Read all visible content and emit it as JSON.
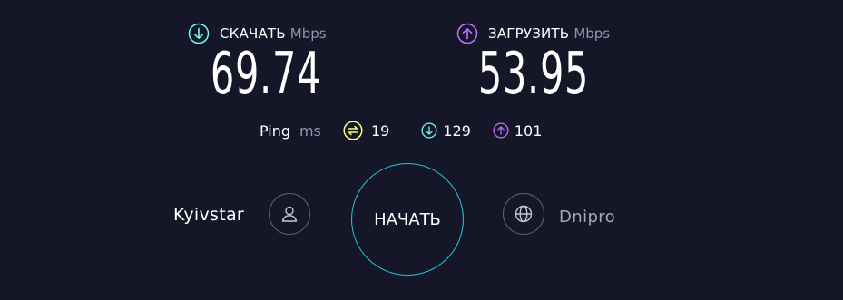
{
  "download": {
    "label": "СКАЧАТЬ",
    "unit": "Mbps",
    "value": "69.74",
    "icon": "download-arrow-icon",
    "color": "#6afff3"
  },
  "upload": {
    "label": "ЗАГРУЗИТЬ",
    "unit": "Mbps",
    "value": "53.95",
    "icon": "upload-arrow-icon",
    "color": "#bf71ff"
  },
  "ping": {
    "label": "Ping",
    "unit": "ms",
    "idle": "19",
    "download": "129",
    "upload": "101",
    "idle_color": "#fbff7a"
  },
  "provider": {
    "name": "Kyivstar",
    "icon": "user-icon"
  },
  "server": {
    "name": "Dnipro",
    "icon": "globe-icon"
  },
  "start_button": {
    "label": "НАЧАТЬ",
    "ring_color": "#1fc8d9"
  }
}
